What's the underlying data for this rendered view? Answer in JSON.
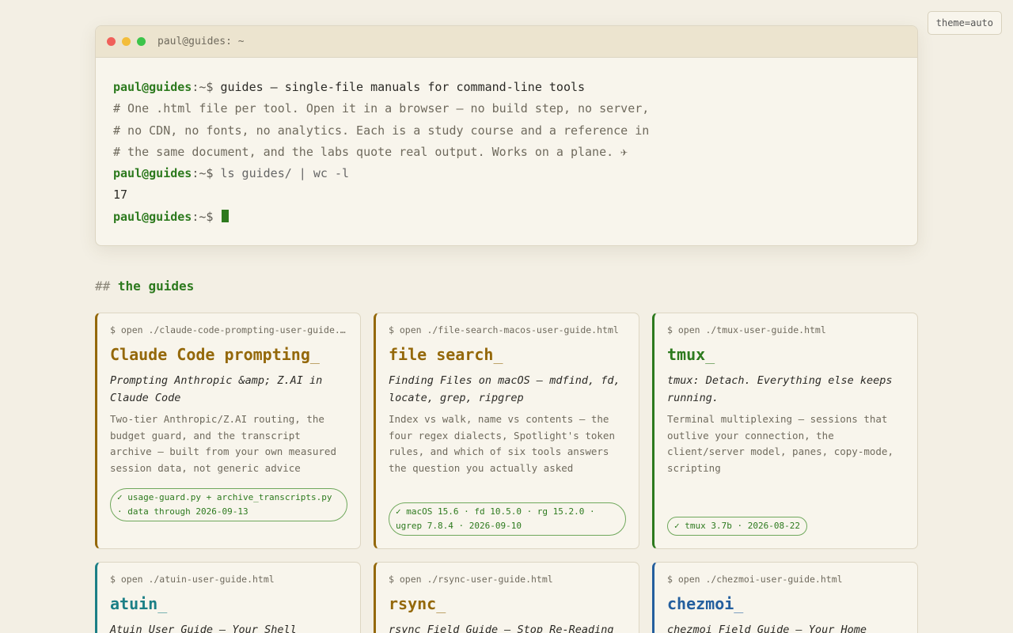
{
  "theme_toggle": "theme=auto",
  "terminal": {
    "title": "paul@guides: ~",
    "user": "paul@guides",
    "path": ":~$",
    "lines": {
      "cmd1": "guides — single-file manuals for command-line tools",
      "c1": "# One .html file per tool. Open it in a browser — no build step, no server,",
      "c2": "# no CDN, no fonts, no analytics. Each is a study course and a reference in",
      "c3": "# the same document, and the labs quote real output. Works on a plane. ✈",
      "cmd2": "ls guides/ | wc -l",
      "out": "17"
    }
  },
  "section": {
    "hash": "##",
    "title": "the guides"
  },
  "colors": {
    "amber": "#94680a",
    "green": "#2d7a1e",
    "teal": "#1b7f86",
    "blue": "#245f9e"
  },
  "cards": [
    {
      "open": "$ open ./claude-code-prompting-user-guide.html",
      "name": "Claude Code prompting",
      "subtitle": "Prompting Anthropic &amp; Z.AI in Claude Code",
      "desc": "Two-tier Anthropic/Z.AI routing, the budget guard, and the transcript archive — built from your own measured session data, not generic advice",
      "badge": "✓ usage-guard.py + archive_transcripts.py · data through 2026-09-13"
    },
    {
      "open": "$ open ./file-search-macos-user-guide.html",
      "name": "file search",
      "subtitle": "Finding Files on macOS — mdfind, fd, locate, grep, ripgrep",
      "desc": "Index vs walk, name vs contents — the four regex dialects, Spotlight's token rules, and which of six tools answers the question you actually asked",
      "badge": "✓ macOS 15.6 · fd 10.5.0 · rg 15.2.0 · ugrep 7.8.4 · 2026-09-10"
    },
    {
      "open": "$ open ./tmux-user-guide.html",
      "name": "tmux",
      "subtitle": "tmux: Detach. Everything else keeps running.",
      "desc": "Terminal multiplexing — sessions that outlive your connection, the client/server model, panes, copy-mode, scripting",
      "badge": "✓ tmux 3.7b · 2026-08-22"
    },
    {
      "open": "$ open ./atuin-user-guide.html",
      "name": "atuin",
      "subtitle": "Atuin User Guide — Your Shell"
    },
    {
      "open": "$ open ./rsync-user-guide.html",
      "name": "rsync",
      "subtitle": "rsync Field Guide — Stop Re-Reading"
    },
    {
      "open": "$ open ./chezmoi-user-guide.html",
      "name": "chezmoi",
      "subtitle": "chezmoi Field Guide — Your Home"
    }
  ]
}
